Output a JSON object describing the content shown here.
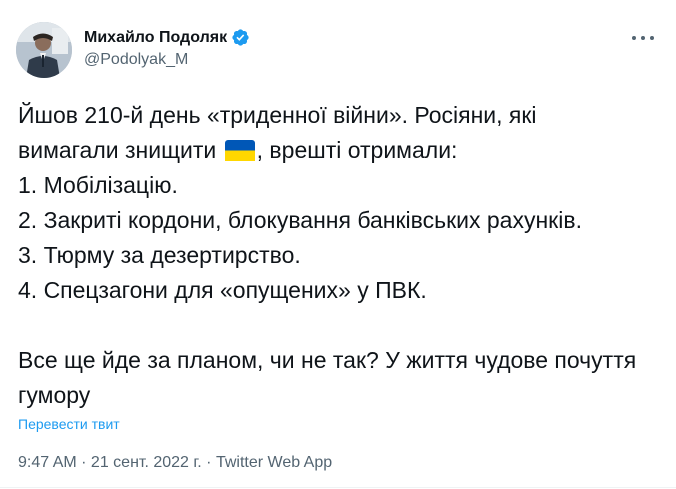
{
  "author": {
    "display_name": "Михайло Подоляк",
    "handle": "@Podolyak_M",
    "verified_icon": "verified-badge-icon",
    "avatar_icon": "avatar-photo"
  },
  "tweet": {
    "line1": "Йшов 210-й день «триденної війни». Росіяни, які",
    "line2_before": "вимагали знищити ",
    "flag_icon": "ukraine-flag-emoji",
    "line2_after": ", врешті отримали:",
    "line3": "1. Мобілізацію.",
    "line4": "2. Закриті кордони, блокування банківських рахунків.",
    "line5": "3. Тюрму за дезертирство.",
    "line6": "4. Спецзагони для «опущених» у ПВК.",
    "line7": "Все ще йде за планом, чи не так? У життя чудове почуття гумору"
  },
  "translate_label": "Перевести твит",
  "meta": {
    "time": "9:47 AM",
    "separator": " · ",
    "date": "21 сент. 2022 г.",
    "source": "Twitter Web App"
  },
  "colors": {
    "accent": "#1d9bf0",
    "secondary_text": "#536471",
    "primary_text": "#0f1419",
    "flag_blue": "#0057b7",
    "flag_yellow": "#ffd700"
  }
}
